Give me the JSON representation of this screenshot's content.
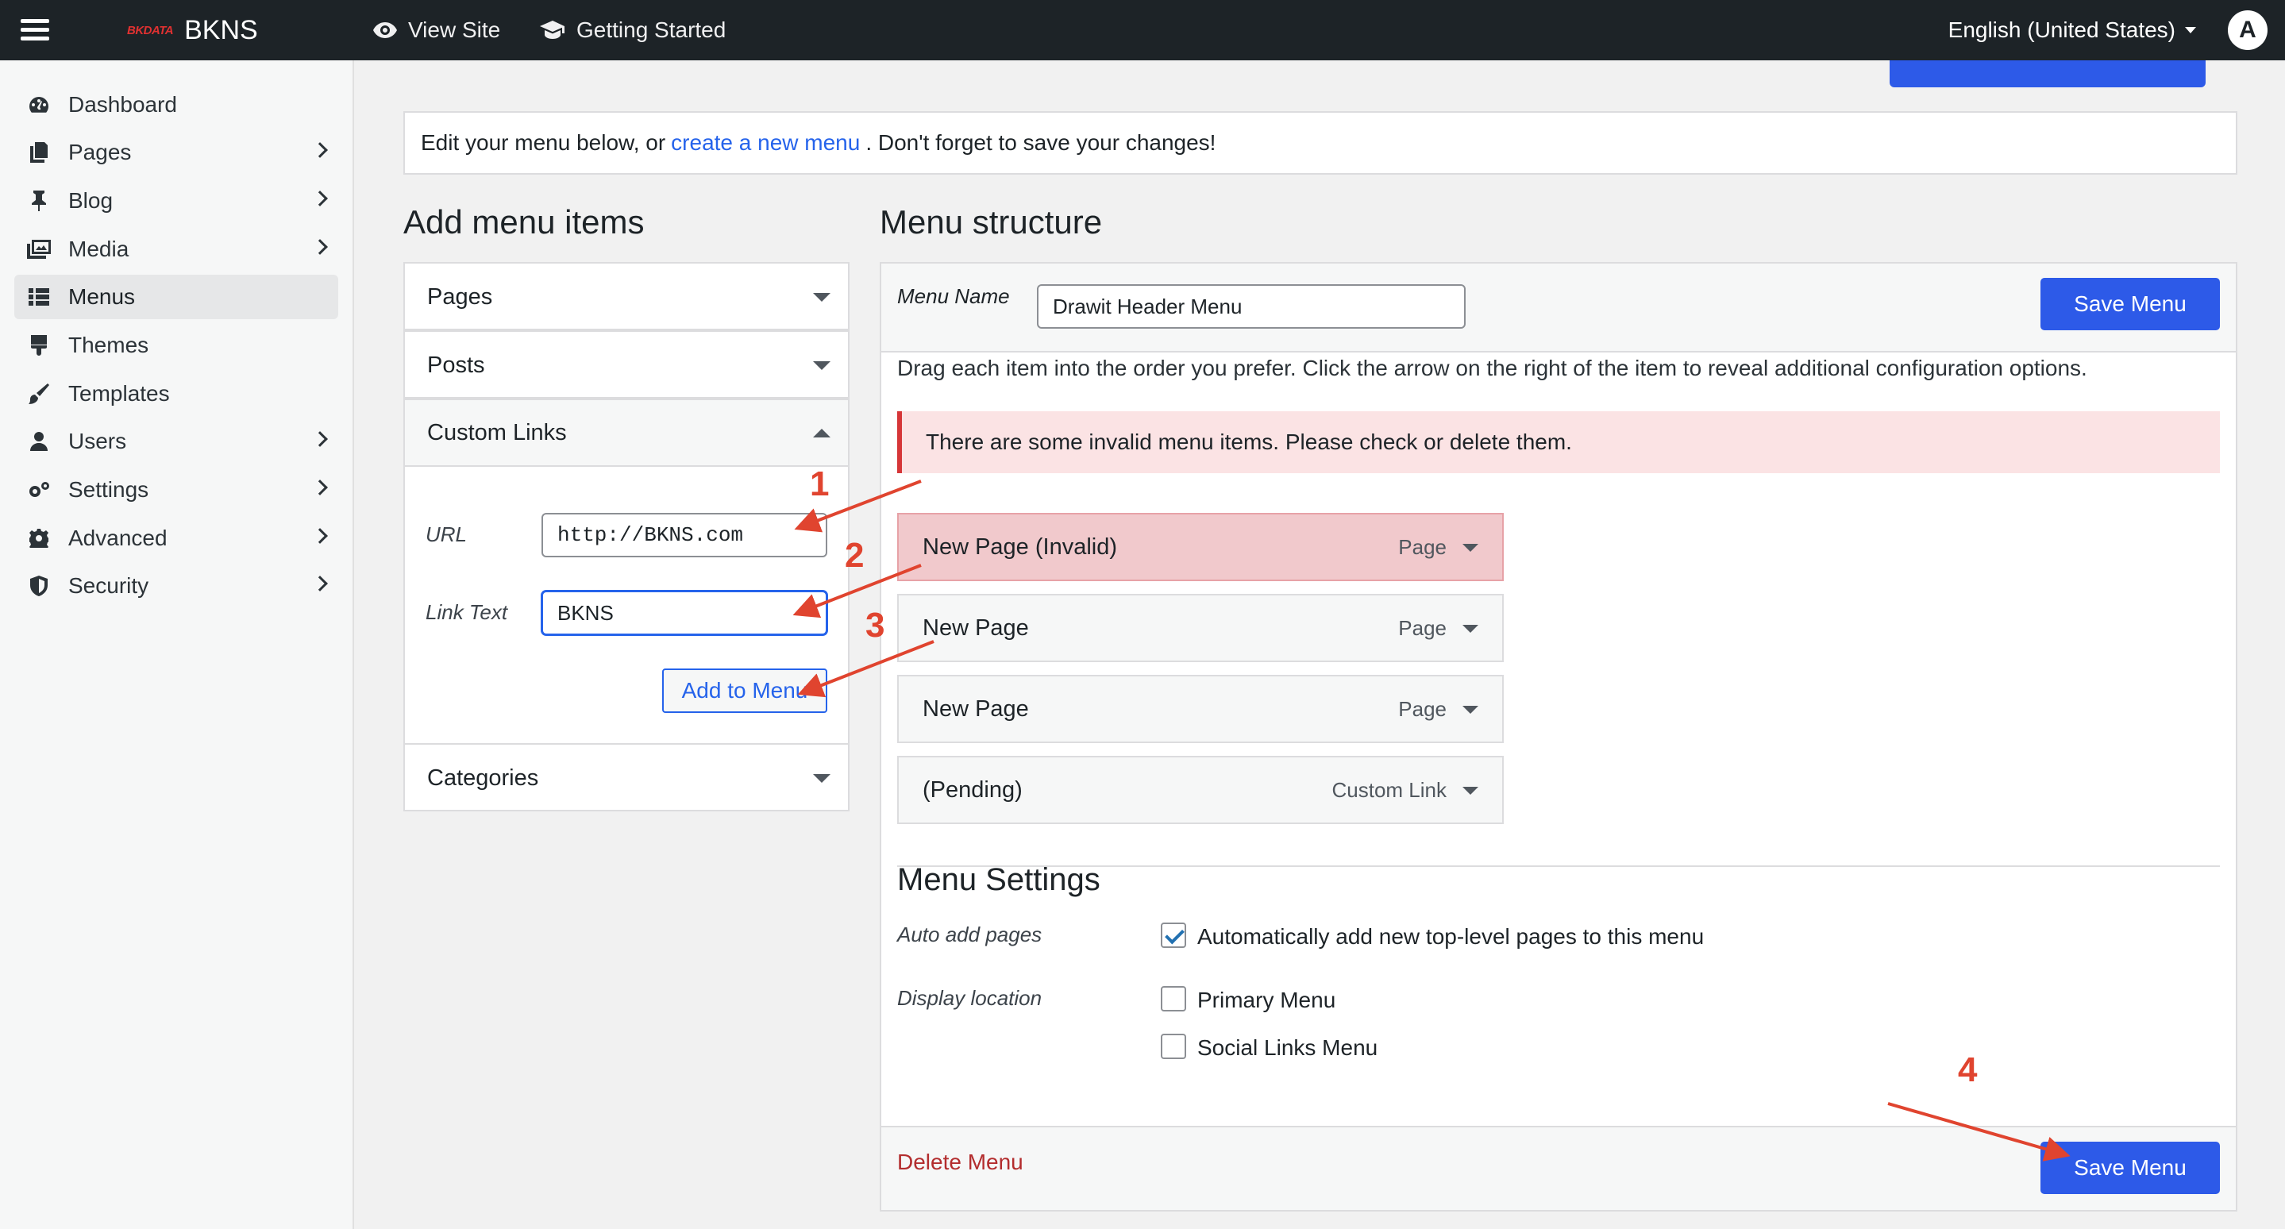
{
  "topbar": {
    "brand_logo": "BKDATA",
    "brand_name": "BKNS",
    "view_site": "View Site",
    "getting_started": "Getting Started",
    "language": "English (United States)",
    "avatar_initial": "A"
  },
  "sidebar": {
    "items": [
      {
        "label": "Dashboard",
        "icon": "dashboard-icon",
        "chevron": false,
        "active": false
      },
      {
        "label": "Pages",
        "icon": "pages-icon",
        "chevron": true,
        "active": false
      },
      {
        "label": "Blog",
        "icon": "pin-icon",
        "chevron": true,
        "active": false
      },
      {
        "label": "Media",
        "icon": "media-icon",
        "chevron": true,
        "active": false
      },
      {
        "label": "Menus",
        "icon": "menus-icon",
        "chevron": false,
        "active": true
      },
      {
        "label": "Themes",
        "icon": "brush-icon",
        "chevron": false,
        "active": false
      },
      {
        "label": "Templates",
        "icon": "paintbrush-icon",
        "chevron": false,
        "active": false
      },
      {
        "label": "Users",
        "icon": "user-icon",
        "chevron": true,
        "active": false
      },
      {
        "label": "Settings",
        "icon": "settings-icon",
        "chevron": true,
        "active": false
      },
      {
        "label": "Advanced",
        "icon": "gear-icon",
        "chevron": true,
        "active": false
      },
      {
        "label": "Security",
        "icon": "shield-icon",
        "chevron": true,
        "active": false
      }
    ]
  },
  "notice": {
    "before": "Edit your menu below, or",
    "link": "create a new menu",
    "after": ". Don't forget to save your changes!"
  },
  "add_items": {
    "title": "Add menu items",
    "sections": {
      "pages": "Pages",
      "posts": "Posts",
      "custom_links": "Custom Links",
      "categories": "Categories"
    },
    "url_label": "URL",
    "url_value": "http://BKNS.com",
    "link_text_label": "Link Text",
    "link_text_value": "BKNS",
    "add_button": "Add to Menu"
  },
  "structure": {
    "title": "Menu structure",
    "menu_name_label": "Menu Name",
    "menu_name_value": "Drawit Header Menu",
    "save_button": "Save Menu",
    "instructions": "Drag each item into the order you prefer. Click the arrow on the right of the item to reveal additional configuration options.",
    "error": "There are some invalid menu items. Please check or delete them.",
    "items": [
      {
        "title": "New Page (Invalid)",
        "type": "Page",
        "invalid": true
      },
      {
        "title": "New Page",
        "type": "Page",
        "invalid": false
      },
      {
        "title": "New Page",
        "type": "Page",
        "invalid": false
      },
      {
        "title": "(Pending)",
        "type": "Custom Link",
        "invalid": false
      }
    ],
    "settings_title": "Menu Settings",
    "auto_add_label": "Auto add pages",
    "auto_add_option": "Automatically add new top-level pages to this menu",
    "auto_add_checked": true,
    "display_location_label": "Display location",
    "locations": [
      {
        "label": "Primary Menu",
        "checked": false
      },
      {
        "label": "Social Links Menu",
        "checked": false
      }
    ],
    "delete_link": "Delete Menu",
    "save_button_bottom": "Save Menu"
  },
  "annotations": [
    "1",
    "2",
    "3",
    "4"
  ],
  "colors": {
    "topbar": "#1d2327",
    "primary": "#2d5ae8",
    "link": "#2563eb",
    "error_bg": "#fbe3e4",
    "error_border": "#d63638",
    "invalid_item": "#f1c9cc",
    "annotation": "#e0442f",
    "delete": "#b32d2e"
  }
}
